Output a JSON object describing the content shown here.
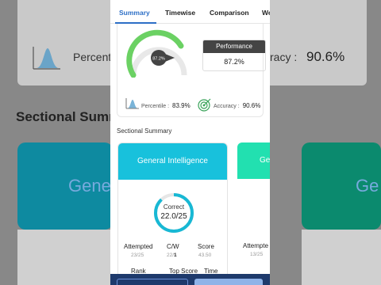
{
  "tabs": [
    "Summary",
    "Timewise",
    "Comparison",
    "We"
  ],
  "performance": {
    "gauge_label": "87.2%",
    "gauge_fraction": 0.872,
    "title": "Performance",
    "value": "87.2%"
  },
  "stats": {
    "percentile_label": "Percentile :",
    "percentile_value": "83.9%",
    "accuracy_label": "Accuracy :",
    "accuracy_value": "90.6%"
  },
  "background": {
    "percentile_label": "Percentile",
    "accuracy_label": "racy :",
    "accuracy_value": "90.6%",
    "section_title": "Sectional Summ",
    "gen_left": "Gene",
    "gen_right": "Ge"
  },
  "sectional": {
    "title": "Sectional Summary",
    "card1": {
      "name": "General Intelligence",
      "correct_label": "Correct",
      "correct_value": "22.0/25",
      "correct_fraction": 0.88,
      "attempted_label": "Attempted",
      "attempted_value": "23/25",
      "cw_label": "C/W",
      "cw_correct": "22",
      "cw_wrong": "1",
      "score_label": "Score",
      "score_value": "43.50",
      "rank_label": "Rank",
      "top_score_label": "Top Score",
      "time_label": "Time"
    },
    "card2": {
      "name": "Ge",
      "attempted_label": "Attempte",
      "attempted_value": "13/25"
    }
  },
  "colors": {
    "accent": "#2d6fc6",
    "card_head": "#18c1dc",
    "card2_head": "#22e0b0",
    "gauge": "#6bd163"
  }
}
